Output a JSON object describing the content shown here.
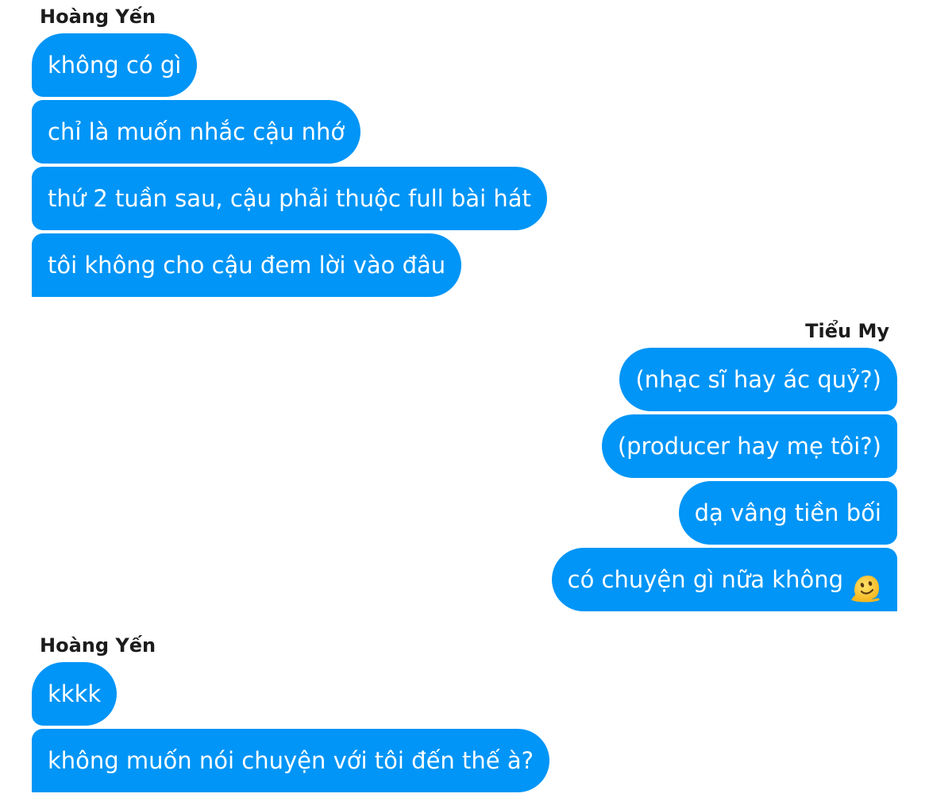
{
  "conversation": {
    "groups": [
      {
        "sender": "Hoàng Yến",
        "side": "left",
        "messages": [
          "không có gì",
          "chỉ là muốn nhắc cậu nhớ",
          "thứ 2 tuần sau, cậu phải thuộc full bài hát",
          "tôi không cho cậu đem lời vào đâu"
        ]
      },
      {
        "sender": "Tiểu My",
        "side": "right",
        "messages": [
          "(nhạc sĩ hay ác quỷ?)",
          "(producer hay mẹ tôi?)",
          "dạ vâng tiền bối",
          "có chuyện gì nữa không"
        ],
        "last_message_emoji": "melting-face-icon"
      },
      {
        "sender": "Hoàng Yến",
        "side": "left",
        "messages": [
          "kkkk",
          "không muốn nói chuyện với tôi đến thế à?"
        ]
      }
    ]
  },
  "colors": {
    "bubble": "#0095f6",
    "bubble_text": "#ffffff",
    "sender_text": "#1c1c1c",
    "background": "#ffffff"
  }
}
